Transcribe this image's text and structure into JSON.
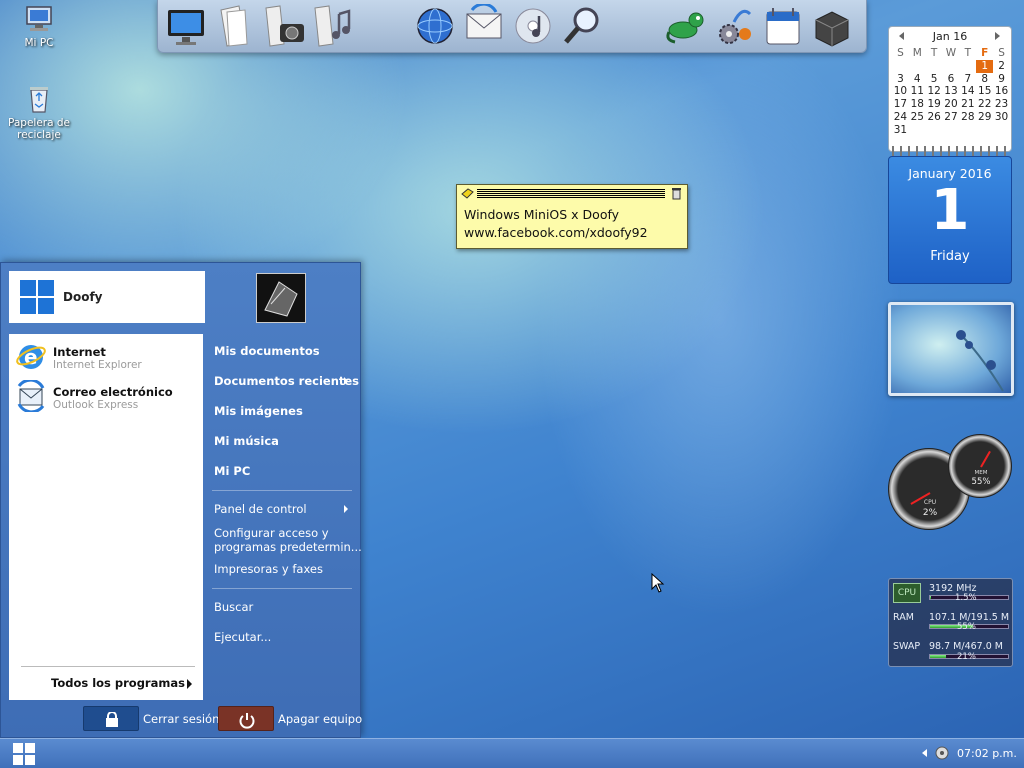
{
  "desktop": {
    "icons": [
      {
        "label": "Mi PC"
      },
      {
        "label": "Papelera de reciclaje"
      }
    ]
  },
  "dock": {
    "icons": [
      "monitor-icon",
      "documents-icon",
      "camera-icon",
      "music-icon",
      "globe-icon",
      "mail-icon",
      "media-icon",
      "search-icon",
      "gecko-icon",
      "settings-icon",
      "calendar-icon",
      "box-icon"
    ]
  },
  "sticky": {
    "line1": "Windows MiniOS x Doofy",
    "line2": "www.facebook.com/xdoofy92"
  },
  "calendar": {
    "month_label": "Jan 16",
    "day_headers": [
      "S",
      "M",
      "T",
      "W",
      "T",
      "F",
      "S"
    ],
    "weeks": [
      [
        "",
        "",
        "",
        "",
        "",
        "1",
        "2"
      ],
      [
        "3",
        "4",
        "5",
        "6",
        "7",
        "8",
        "9"
      ],
      [
        "10",
        "11",
        "12",
        "13",
        "14",
        "15",
        "16"
      ],
      [
        "17",
        "18",
        "19",
        "20",
        "21",
        "22",
        "23"
      ],
      [
        "24",
        "25",
        "26",
        "27",
        "28",
        "29",
        "30"
      ],
      [
        "31",
        "",
        "",
        "",
        "",
        "",
        ""
      ]
    ],
    "accent": "#e46b10"
  },
  "big_calendar": {
    "month_year": "January 2016",
    "day": "1",
    "weekday": "Friday"
  },
  "gauges": {
    "cpu_label": "CPU",
    "cpu_value": "2%",
    "mem_label": "MEM",
    "mem_value": "55%"
  },
  "sysmon": {
    "cpu_label": "CPU",
    "cpu_freq": "3192 MHz",
    "cpu_pct": "1.5%",
    "cpu_fraction": 0.015,
    "ram_label": "RAM",
    "ram_usage": "107.1 M/191.5 M",
    "ram_pct": "55%",
    "ram_fraction": 0.55,
    "swap_label": "SWAP",
    "swap_usage": "98.7 M/467.0 M",
    "swap_pct": "21%",
    "swap_fraction": 0.21
  },
  "start_menu": {
    "user_name": "Doofy",
    "pinned": [
      {
        "title": "Internet",
        "subtitle": "Internet Explorer"
      },
      {
        "title": "Correo electrónico",
        "subtitle": "Outlook Express"
      }
    ],
    "all_programs": "Todos los programas",
    "right_items": {
      "my_documents": "Mis documentos",
      "recent_documents": "Documentos recientes",
      "my_pictures": "Mis imágenes",
      "my_music": "Mi música",
      "my_pc": "Mi PC",
      "control_panel": "Panel de control",
      "default_programs_1": "Configurar acceso y",
      "default_programs_2": "programas predetermin...",
      "printers": "Impresoras y faxes",
      "search": "Buscar",
      "run": "Ejecutar..."
    },
    "logoff": "Cerrar sesión",
    "shutdown": "Apagar equipo"
  },
  "taskbar": {
    "clock": "07:02 p.m."
  }
}
